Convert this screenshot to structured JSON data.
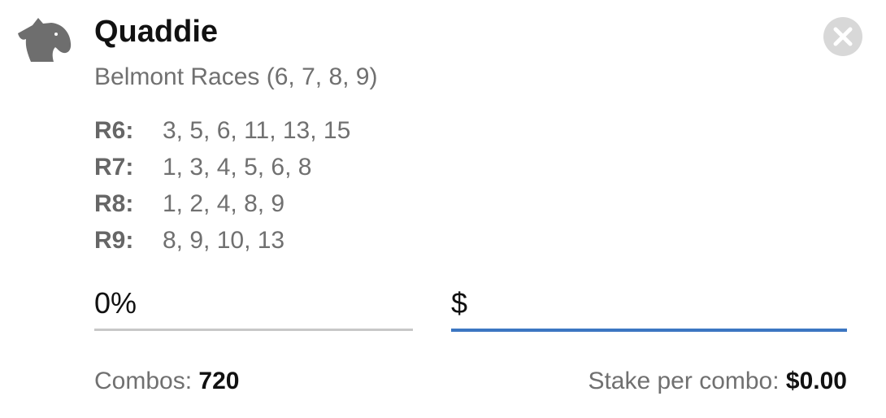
{
  "bet": {
    "icon": "horse-head-icon",
    "title": "Quaddie",
    "subtitle": "Belmont Races (6, 7, 8, 9)",
    "legs": [
      {
        "label": "R6:",
        "runners": "3, 5, 6, 11, 13, 15"
      },
      {
        "label": "R7:",
        "runners": "1, 3, 4, 5, 6, 8"
      },
      {
        "label": "R8:",
        "runners": "1, 2, 4, 8, 9"
      },
      {
        "label": "R9:",
        "runners": "8, 9, 10, 13"
      }
    ]
  },
  "inputs": {
    "percent_value": "0%",
    "stake_value": "$"
  },
  "summary": {
    "combos_label": "Combos:",
    "combos_value": "720",
    "stake_label": "Stake per combo:",
    "stake_value": "$0.00"
  },
  "actions": {
    "close_icon": "close-icon"
  },
  "colors": {
    "active_underline": "#3c76c2",
    "inactive_underline": "#c8c8c8",
    "icon_gray": "#6e6e6e",
    "close_bg": "#d8d8d8"
  }
}
